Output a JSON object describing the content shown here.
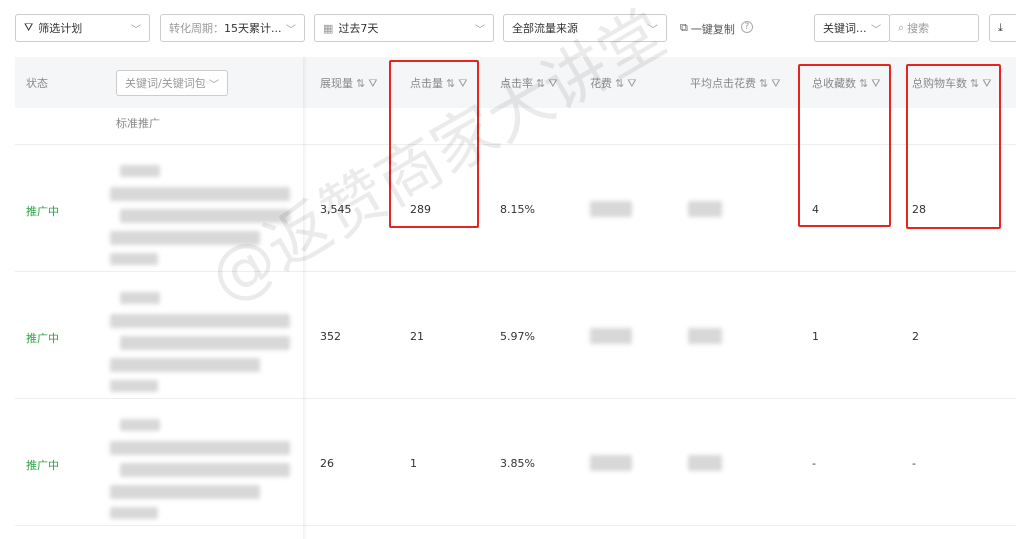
{
  "toolbar": {
    "filter_plan": "筛选计划",
    "conversion_period_label": "转化周期：",
    "conversion_period_value": "15天累计...",
    "date_range": "过去7天",
    "traffic_source": "全部流量来源",
    "copy_label": "一键复制",
    "help": "?",
    "search_type": "关键词...",
    "search_placeholder": "搜索"
  },
  "table": {
    "columns": {
      "status": "状态",
      "keyword_select": "关键词/关键词包",
      "impressions": "展现量",
      "clicks": "点击量",
      "ctr": "点击率",
      "cost": "花费",
      "avg_cpc": "平均点击花费",
      "favorites": "总收藏数",
      "cart": "总购物车数"
    },
    "sort_icon": "⇅",
    "group_label": "标准推广",
    "rows": [
      {
        "status": "推广中",
        "impressions": "3,545",
        "clicks": "289",
        "ctr": "8.15%",
        "favorites": "4",
        "cart": "28"
      },
      {
        "status": "推广中",
        "impressions": "352",
        "clicks": "21",
        "ctr": "5.97%",
        "favorites": "1",
        "cart": "2"
      },
      {
        "status": "推广中",
        "impressions": "26",
        "clicks": "1",
        "ctr": "3.85%",
        "favorites": "-",
        "cart": "-"
      }
    ]
  },
  "watermark": "@返赞商家大讲堂",
  "colors": {
    "status_green": "#2aa342",
    "highlight_red": "#e5261f"
  }
}
